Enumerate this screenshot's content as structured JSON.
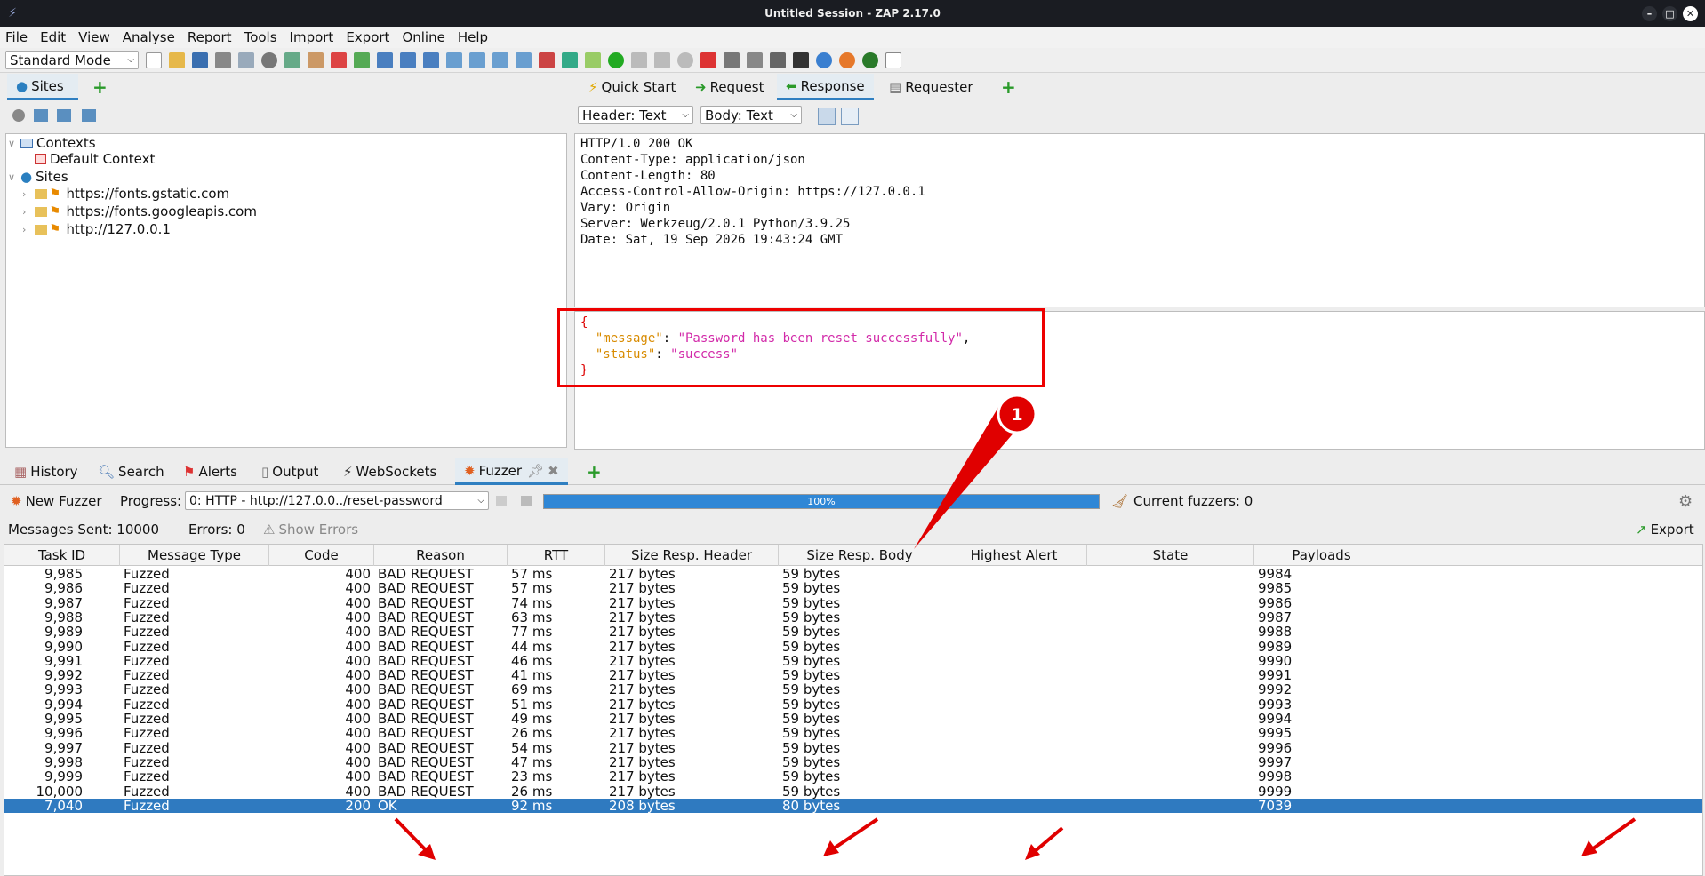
{
  "window": {
    "title": "Untitled Session - ZAP 2.17.0"
  },
  "menu": [
    "File",
    "Edit",
    "View",
    "Analyse",
    "Report",
    "Tools",
    "Import",
    "Export",
    "Online",
    "Help"
  ],
  "toolbar": {
    "mode": "Standard Mode"
  },
  "left_tabs": {
    "sites": "Sites"
  },
  "tree": {
    "contexts": "Contexts",
    "default_context": "Default Context",
    "sites": "Sites",
    "site1": "https://fonts.gstatic.com",
    "site2": "https://fonts.googleapis.com",
    "site3": "http://127.0.0.1"
  },
  "right_tabs": {
    "quick_start": "Quick Start",
    "request": "Request",
    "response": "Response",
    "requester": "Requester"
  },
  "response_view": {
    "header_select": "Header: Text",
    "body_select": "Body: Text"
  },
  "response_header_lines": [
    "HTTP/1.0 200 OK",
    "Content-Type: application/json",
    "Content-Length: 80",
    "Access-Control-Allow-Origin: https://127.0.0.1",
    "Vary: Origin",
    "Server: Werkzeug/2.0.1 Python/3.9.25",
    "Date: Sat, 19 Sep 2026 19:43:24 GMT"
  ],
  "response_body": {
    "open": "{",
    "message_key": "\"message\"",
    "message_value": "\"Password has been reset successfully\"",
    "status_key": "\"status\"",
    "status_value": "\"success\"",
    "close": "}"
  },
  "annotation": {
    "badge": "1",
    "color": "#e00000"
  },
  "bottom_tabs": {
    "history": "History",
    "search": "Search",
    "alerts": "Alerts",
    "output": "Output",
    "websockets": "WebSockets",
    "fuzzer": "Fuzzer"
  },
  "fuzzer": {
    "new_fuzzer": "New Fuzzer",
    "progress_label": "Progress:",
    "progress_select": "0: HTTP - http://127.0.0../reset-password",
    "progress_text": "100%",
    "progress_value": 1.0,
    "current_fuzzers": "Current fuzzers: 0",
    "messages_sent": "Messages Sent: 10000",
    "errors": "Errors: 0",
    "show_errors": "Show Errors",
    "export": "Export"
  },
  "table": {
    "columns": [
      "Task ID",
      "Message Type",
      "Code",
      "Reason",
      "RTT",
      "Size Resp. Header",
      "Size Resp. Body",
      "Highest Alert",
      "State",
      "Payloads"
    ],
    "rows": [
      [
        "9,985",
        "Fuzzed",
        "400",
        "BAD REQUEST",
        "57 ms",
        "217 bytes",
        "59 bytes",
        "",
        "",
        "9984"
      ],
      [
        "9,986",
        "Fuzzed",
        "400",
        "BAD REQUEST",
        "57 ms",
        "217 bytes",
        "59 bytes",
        "",
        "",
        "9985"
      ],
      [
        "9,987",
        "Fuzzed",
        "400",
        "BAD REQUEST",
        "74 ms",
        "217 bytes",
        "59 bytes",
        "",
        "",
        "9986"
      ],
      [
        "9,988",
        "Fuzzed",
        "400",
        "BAD REQUEST",
        "63 ms",
        "217 bytes",
        "59 bytes",
        "",
        "",
        "9987"
      ],
      [
        "9,989",
        "Fuzzed",
        "400",
        "BAD REQUEST",
        "77 ms",
        "217 bytes",
        "59 bytes",
        "",
        "",
        "9988"
      ],
      [
        "9,990",
        "Fuzzed",
        "400",
        "BAD REQUEST",
        "44 ms",
        "217 bytes",
        "59 bytes",
        "",
        "",
        "9989"
      ],
      [
        "9,991",
        "Fuzzed",
        "400",
        "BAD REQUEST",
        "46 ms",
        "217 bytes",
        "59 bytes",
        "",
        "",
        "9990"
      ],
      [
        "9,992",
        "Fuzzed",
        "400",
        "BAD REQUEST",
        "41 ms",
        "217 bytes",
        "59 bytes",
        "",
        "",
        "9991"
      ],
      [
        "9,993",
        "Fuzzed",
        "400",
        "BAD REQUEST",
        "69 ms",
        "217 bytes",
        "59 bytes",
        "",
        "",
        "9992"
      ],
      [
        "9,994",
        "Fuzzed",
        "400",
        "BAD REQUEST",
        "51 ms",
        "217 bytes",
        "59 bytes",
        "",
        "",
        "9993"
      ],
      [
        "9,995",
        "Fuzzed",
        "400",
        "BAD REQUEST",
        "49 ms",
        "217 bytes",
        "59 bytes",
        "",
        "",
        "9994"
      ],
      [
        "9,996",
        "Fuzzed",
        "400",
        "BAD REQUEST",
        "26 ms",
        "217 bytes",
        "59 bytes",
        "",
        "",
        "9995"
      ],
      [
        "9,997",
        "Fuzzed",
        "400",
        "BAD REQUEST",
        "54 ms",
        "217 bytes",
        "59 bytes",
        "",
        "",
        "9996"
      ],
      [
        "9,998",
        "Fuzzed",
        "400",
        "BAD REQUEST",
        "47 ms",
        "217 bytes",
        "59 bytes",
        "",
        "",
        "9997"
      ],
      [
        "9,999",
        "Fuzzed",
        "400",
        "BAD REQUEST",
        "23 ms",
        "217 bytes",
        "59 bytes",
        "",
        "",
        "9998"
      ],
      [
        "10,000",
        "Fuzzed",
        "400",
        "BAD REQUEST",
        "26 ms",
        "217 bytes",
        "59 bytes",
        "",
        "",
        "9999"
      ],
      [
        "7,040",
        "Fuzzed",
        "200",
        "OK",
        "92 ms",
        "208 bytes",
        "80 bytes",
        "",
        "",
        "7039"
      ]
    ],
    "selected_row": 16
  }
}
